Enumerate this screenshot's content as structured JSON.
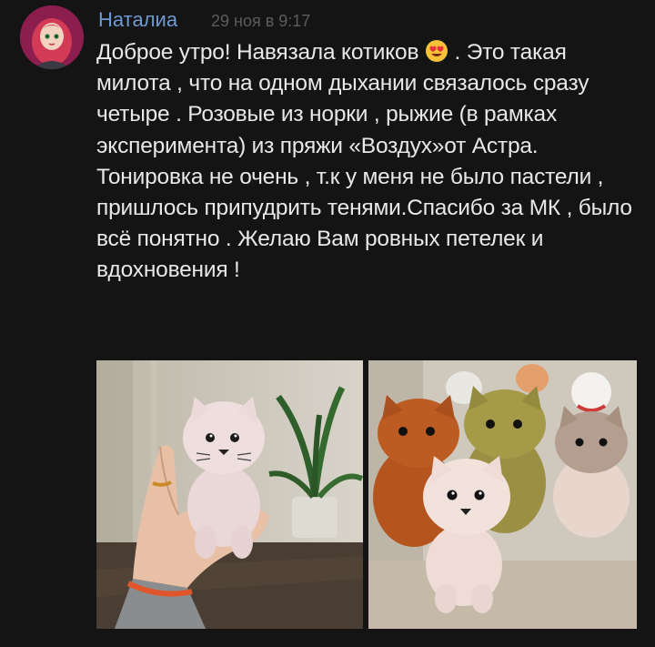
{
  "post": {
    "author": "Наталиа",
    "timestamp": "29 ноя в 9:17",
    "text_before_emoji": "Доброе утро! Навязала котиков",
    "emoji": "smiling-face-with-heart-eyes",
    "text_after_emoji": " . Это такая милота , что на одном дыхании связалось сразу четыре . Розовые из норки , рыжие (в рамках эксперимента) из пряжи «Воздух»от Астра. Тонировка не очень , т.к у меня не было пастели , пришлось припудрить тенями.Спасибо за МК , было всё понятно . Желаю Вам ровных петелек и вдохновения !"
  },
  "colors": {
    "background": "#141414",
    "author": "#6f9ad0",
    "text": "#e8e8e8",
    "timestamp": "#5c5c5c"
  }
}
